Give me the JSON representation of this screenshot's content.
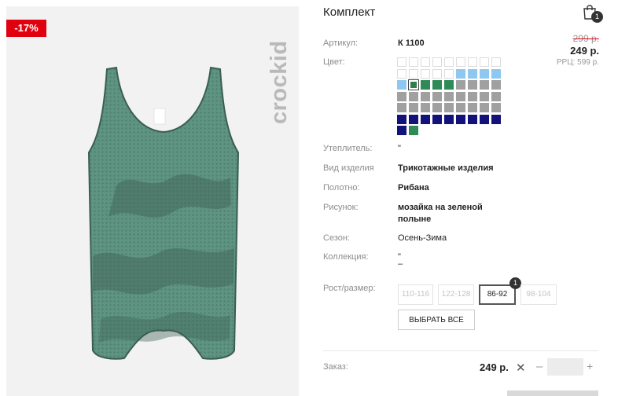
{
  "product": {
    "title": "Комплект",
    "discount": "-17%",
    "brand": "crockid",
    "old_price": "299 р.",
    "price": "249 р.",
    "rrp": "РРЦ: 599 р."
  },
  "cart": {
    "icon": "shopping-bag-icon",
    "count": "1"
  },
  "attributes": [
    {
      "label": "Артикул:",
      "value": "К 1100"
    },
    {
      "label": "Цвет:",
      "value": ""
    },
    {
      "label": "Утеплитель:",
      "value": "\""
    },
    {
      "label": "Вид изделия",
      "value": "Трикотажные изделия"
    },
    {
      "label": "Полотно:",
      "value": "Рибана"
    },
    {
      "label": "Рисунок:",
      "value_line1": "мозайка на зеленой",
      "value_line2": "полыне"
    },
    {
      "label": "Сезон:",
      "value": "Осень-Зима"
    },
    {
      "label": "Коллекция:",
      "value_line1": "\"",
      "value_line2": "–"
    }
  ],
  "colors": {
    "rows": [
      [
        "#ffffff",
        "#ffffff",
        "#ffffff",
        "#ffffff",
        "#ffffff",
        "#ffffff",
        "#ffffff",
        "#ffffff",
        "#ffffff"
      ],
      [
        "#ffffff",
        "#ffffff",
        "#ffffff",
        "#ffffff",
        "#ffffff",
        "#8ec8f0",
        "#8ec8f0",
        "#8ec8f0",
        "#8ec8f0"
      ],
      [
        "#8ec8f0",
        "#2e7d4a",
        "#2e8b57",
        "#2e8b57",
        "#2e8b57",
        "#a0a0a0",
        "#a0a0a0",
        "#a0a0a0",
        "#a0a0a0"
      ],
      [
        "#a0a0a0",
        "#a0a0a0",
        "#a0a0a0",
        "#a0a0a0",
        "#a0a0a0",
        "#a0a0a0",
        "#a0a0a0",
        "#a0a0a0",
        "#a0a0a0"
      ],
      [
        "#a0a0a0",
        "#a0a0a0",
        "#a0a0a0",
        "#a0a0a0",
        "#a0a0a0",
        "#a0a0a0",
        "#a0a0a0",
        "#a0a0a0",
        "#a0a0a0"
      ],
      [
        "#12127a",
        "#12127a",
        "#12127a",
        "#12127a",
        "#12127a",
        "#12127a",
        "#12127a",
        "#12127a",
        "#12127a"
      ],
      [
        "#12127a",
        "#2e8b57"
      ]
    ],
    "selected_row": 2,
    "selected_col": 1
  },
  "sizes": {
    "label": "Рост/размер:",
    "options": [
      "110-116",
      "122-128",
      "86-92",
      "98-104"
    ],
    "active": "86-92",
    "active_count": "1",
    "select_all_label": "ВЫБРАТЬ ВСЕ"
  },
  "order": {
    "label": "Заказ:",
    "price": "249 р.",
    "remove_icon": "close-icon",
    "minus": "–",
    "plus": "+",
    "quantity": ""
  },
  "theme": {
    "badge_color": "#e1000f",
    "garment_color": "#5f9482"
  }
}
